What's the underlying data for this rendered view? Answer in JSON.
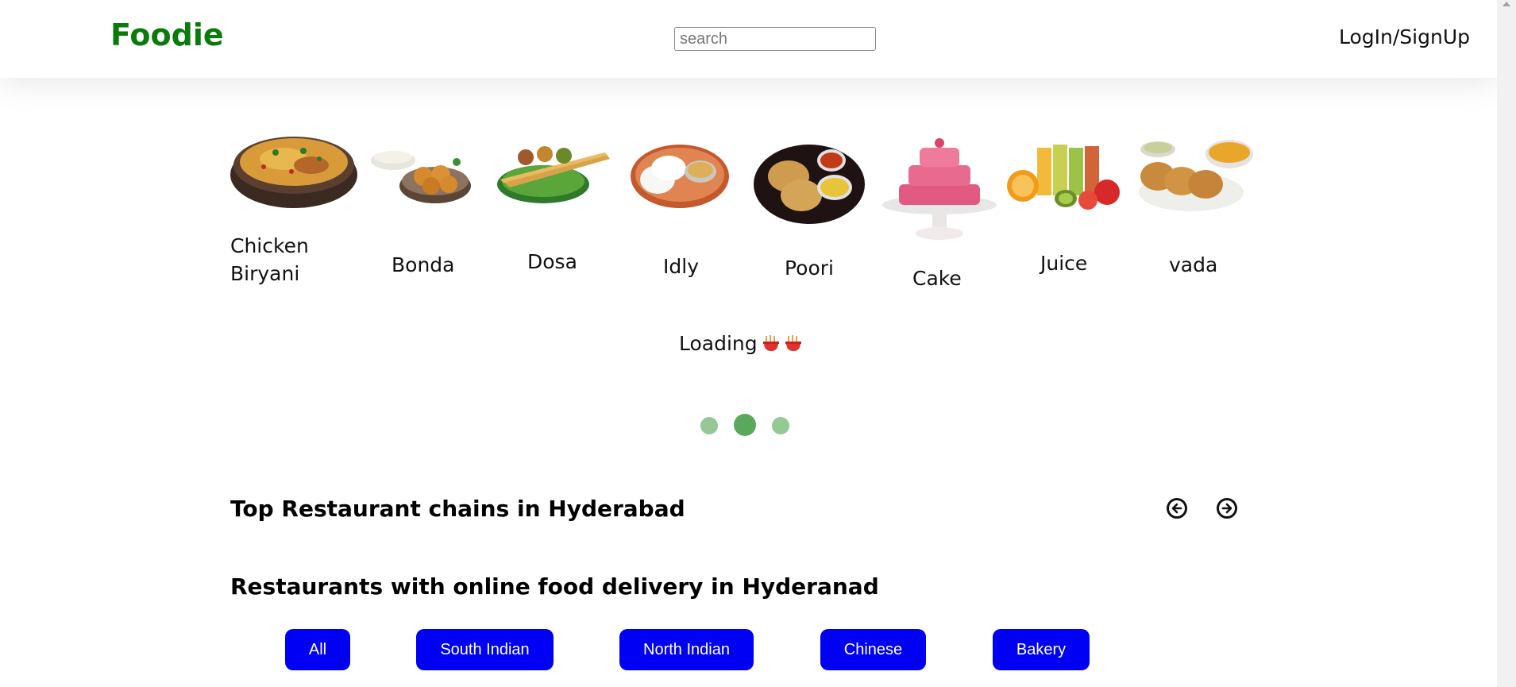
{
  "header": {
    "logo": "Foodie",
    "search_placeholder": "search",
    "login_label": "LogIn/SignUp"
  },
  "colors": {
    "logo_green": "#0a7a0a",
    "filter_blue": "#0000f5",
    "dot_inactive": "#92c994",
    "dot_active": "#5aa85d"
  },
  "foods": [
    {
      "name": "Chicken Biryani",
      "line1": "Chicken",
      "line2": "Biryani"
    },
    {
      "name": "Bonda"
    },
    {
      "name": "Dosa"
    },
    {
      "name": "Idly"
    },
    {
      "name": "Poori"
    },
    {
      "name": "Cake"
    },
    {
      "name": "Juice"
    },
    {
      "name": "vada"
    }
  ],
  "loading": {
    "text": "Loading",
    "icon": "noodle-bowl-emoji"
  },
  "carousel": {
    "dots": 3,
    "active_index": 1
  },
  "sections": {
    "top_chains": "Top Restaurant chains in Hyderabad",
    "online_delivery": "Restaurants with online food delivery in Hyderanad"
  },
  "filters": [
    "All",
    "South Indian",
    "North Indian",
    "Chinese",
    "Bakery"
  ]
}
